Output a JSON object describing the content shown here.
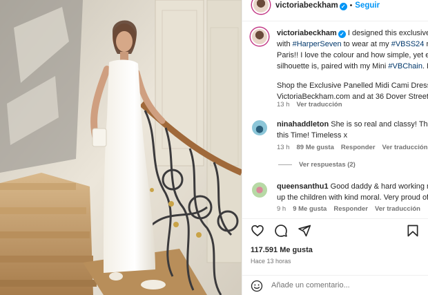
{
  "header": {
    "username": "victoriabeckham",
    "follow_label": "Seguir"
  },
  "caption": {
    "username": "victoriabeckham",
    "line1": " I designed this exclusive M",
    "line2_prefix": "with ",
    "line2_tag1": "#HarperSeven",
    "line2_mid": " to wear at my ",
    "line2_tag2": "#VBSS24",
    "line2_suffix": " run",
    "line3": "Paris!! I love the colour and how simple, yet ele",
    "line4_prefix": "silhouette is, paired with my Mini ",
    "line4_tag": "#VBChain",
    "line4_suffix": ". Kis",
    "line5": "Shop the Exclusive Panelled Midi Cami Dress in",
    "line6": "VictoriaBeckham.com and at 36 Dover Street.",
    "time": "13 h",
    "translate": "Ver traducción"
  },
  "comments": [
    {
      "username": "ninahaddleton",
      "text1": " She is so real and classy! The be",
      "text2": "this Time! Timeless x",
      "time": "13 h",
      "likes": "89 Me gusta",
      "reply": "Responder",
      "translate": "Ver traducción",
      "view_replies": "Ver respuestas (2)"
    },
    {
      "username": "queensanthu1",
      "text1": " Good daddy & hard working mu",
      "text2": "up the children with kind moral. Very proud of y",
      "time": "9 h",
      "likes": "9 Me gusta",
      "reply": "Responder",
      "translate": "Ver traducción"
    }
  ],
  "stats": {
    "likes": "117.591 Me gusta",
    "time_ago": "Hace 13 horas"
  },
  "comment_box": {
    "placeholder": "Añade un comentario..."
  },
  "colors": {
    "accent": "#0095f6",
    "hashtag": "#00376b",
    "muted": "#737373"
  },
  "icons": [
    "heart-icon",
    "comment-icon",
    "share-icon",
    "bookmark-icon",
    "emoji-icon",
    "verified-icon"
  ]
}
